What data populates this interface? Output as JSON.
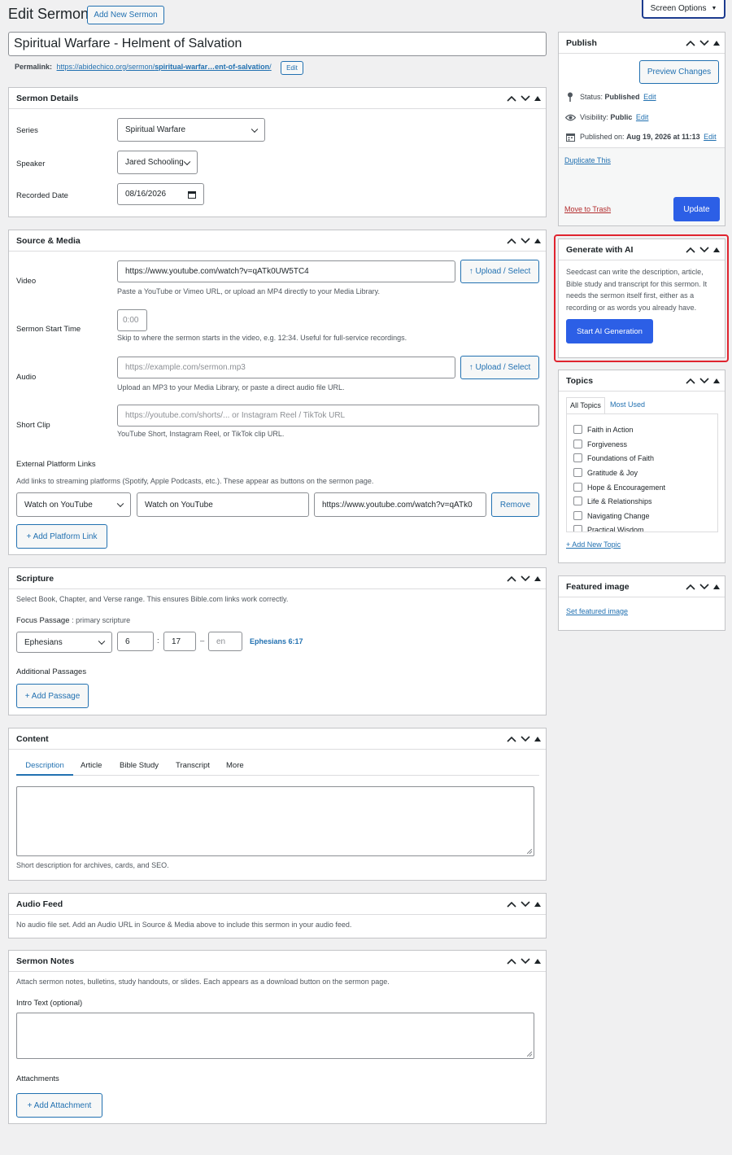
{
  "header": {
    "page_title": "Edit Sermon",
    "add_new_label": "Add New Sermon",
    "screen_options_label": "Screen Options"
  },
  "title_field": {
    "value": "Spiritual Warfare - Helment of Salvation"
  },
  "permalink": {
    "label": "Permalink:",
    "url_prefix": "https://abidechico.org/sermon/",
    "url_slug": "spiritual-warfar…ent-of-salvation",
    "url_suffix": "/",
    "edit_label": "Edit"
  },
  "sermon_details": {
    "title": "Sermon Details",
    "series_label": "Series",
    "series_value": "Spiritual Warfare",
    "speaker_label": "Speaker",
    "speaker_value": "Jared Schooling",
    "recorded_label": "Recorded Date",
    "recorded_value": "08/16/2026"
  },
  "source_media": {
    "title": "Source & Media",
    "video_label": "Video",
    "video_value": "https://www.youtube.com/watch?v=qATk0UW5TC4",
    "upload_label": "↑ Upload / Select",
    "video_help": "Paste a YouTube or Vimeo URL, or upload an MP4 directly to your Media Library.",
    "start_label": "Sermon Start Time",
    "start_placeholder": "0:00",
    "start_help": "Skip to where the sermon starts in the video, e.g. 12:34. Useful for full-service recordings.",
    "audio_label": "Audio",
    "audio_placeholder": "https://example.com/sermon.mp3",
    "audio_help": "Upload an MP3 to your Media Library, or paste a direct audio file URL.",
    "clip_label": "Short Clip",
    "clip_placeholder": "https://youtube.com/shorts/... or Instagram Reel / TikTok URL",
    "clip_help": "YouTube Short, Instagram Reel, or TikTok clip URL.",
    "ext_title": "External Platform Links",
    "ext_help": "Add links to streaming platforms (Spotify, Apple Podcasts, etc.). These appear as buttons on the sermon page.",
    "platform_select": "Watch on YouTube",
    "platform_label": "Watch on YouTube",
    "platform_url": "https://www.youtube.com/watch?v=qATk0",
    "remove_label": "Remove",
    "add_platform_label": "+ Add Platform Link"
  },
  "scripture": {
    "title": "Scripture",
    "help": "Select Book, Chapter, and Verse range. This ensures Bible.com links work correctly.",
    "focus_label": "Focus Passage",
    "focus_note": ": primary scripture",
    "book": "Ephesians",
    "chapter": "6",
    "colon": ":",
    "verse": "17",
    "dash": "–",
    "end_placeholder": "en",
    "reference": "Ephesians 6:17",
    "additional_label": "Additional Passages",
    "add_passage_label": "+ Add Passage"
  },
  "content": {
    "title": "Content",
    "tabs": [
      "Description",
      "Article",
      "Bible Study",
      "Transcript",
      "More"
    ],
    "help": "Short description for archives, cards, and SEO."
  },
  "audio_feed": {
    "title": "Audio Feed",
    "text": "No audio file set. Add an Audio URL in Source & Media above to include this sermon in your audio feed."
  },
  "sermon_notes": {
    "title": "Sermon Notes",
    "help": "Attach sermon notes, bulletins, study handouts, or slides. Each appears as a download button on the sermon page.",
    "intro_label": "Intro Text (optional)",
    "attachments_label": "Attachments",
    "add_attachment_label": "+ Add Attachment"
  },
  "publish": {
    "title": "Publish",
    "preview_label": "Preview Changes",
    "status_label": "Status:",
    "status_value": "Published",
    "visibility_label": "Visibility:",
    "visibility_value": "Public",
    "published_label": "Published on:",
    "published_value": "Aug 19, 2026 at 11:13",
    "edit_label": "Edit",
    "duplicate_label": "Duplicate This",
    "trash_label": "Move to Trash",
    "update_label": "Update"
  },
  "ai": {
    "title": "Generate with AI",
    "description": "Seedcast can write the description, article, Bible study and transcript for this sermon. It needs the sermon itself first, either as a recording or as words you already have.",
    "button_label": "Start AI Generation",
    "highlight_color": "#e0242f"
  },
  "topics": {
    "title": "Topics",
    "tab_all": "All Topics",
    "tab_most": "Most Used",
    "items": [
      "Faith in Action",
      "Forgiveness",
      "Foundations of Faith",
      "Gratitude & Joy",
      "Hope & Encouragement",
      "Life & Relationships",
      "Navigating Change",
      "Practical Wisdom"
    ],
    "add_label": "+ Add New Topic"
  },
  "featured_image": {
    "title": "Featured image",
    "set_label": "Set featured image"
  },
  "colors": {
    "accent": "#2271b1",
    "primary_button": "#2c5fe6",
    "trash": "#b32d2e"
  }
}
